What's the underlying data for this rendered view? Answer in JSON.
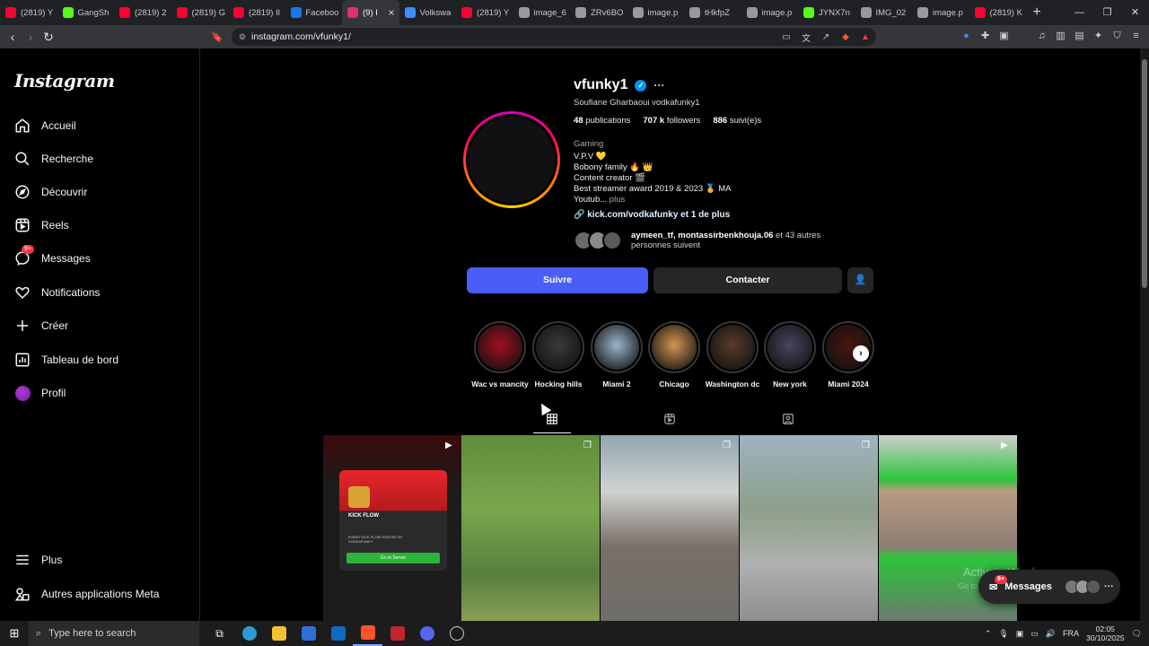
{
  "browser": {
    "tabs": [
      {
        "title": "(2819) Y",
        "color": "#ff0033"
      },
      {
        "title": "GangSh",
        "color": "#53fc18"
      },
      {
        "title": "(2819) 2",
        "color": "#ff0033"
      },
      {
        "title": "(2819) G",
        "color": "#ff0033"
      },
      {
        "title": "(2819) Il",
        "color": "#ff0033"
      },
      {
        "title": "Faceboo",
        "color": "#1877f2"
      },
      {
        "title": "(9) I",
        "color": "#e1306c",
        "active": true
      },
      {
        "title": "Volkswa",
        "color": "#3c8dff"
      },
      {
        "title": "(2819) Y",
        "color": "#ff0033"
      },
      {
        "title": "image_6",
        "color": "#999999"
      },
      {
        "title": "ZRv6BO",
        "color": "#999999"
      },
      {
        "title": "image.p",
        "color": "#999999"
      },
      {
        "title": "tHkfpZ",
        "color": "#999999"
      },
      {
        "title": "image.p",
        "color": "#999999"
      },
      {
        "title": "JYNX7n",
        "color": "#53fc18"
      },
      {
        "title": "IMG_02",
        "color": "#999999"
      },
      {
        "title": "image.p",
        "color": "#999999"
      },
      {
        "title": "(2819) K",
        "color": "#ff0033"
      }
    ],
    "new_tab": "+",
    "url": "instagram.com/vfunky1/"
  },
  "sidebar": {
    "logo": "Instagram",
    "items": [
      {
        "label": "Accueil",
        "icon": "home-icon"
      },
      {
        "label": "Recherche",
        "icon": "search-icon"
      },
      {
        "label": "Découvrir",
        "icon": "compass-icon"
      },
      {
        "label": "Reels",
        "icon": "reels-icon"
      },
      {
        "label": "Messages",
        "icon": "messenger-icon",
        "badge": "9+"
      },
      {
        "label": "Notifications",
        "icon": "heart-icon"
      },
      {
        "label": "Créer",
        "icon": "plus-icon"
      },
      {
        "label": "Tableau de bord",
        "icon": "dashboard-icon"
      },
      {
        "label": "Profil",
        "icon": "avatar-icon"
      }
    ],
    "bottom": [
      {
        "label": "Plus",
        "icon": "menu-icon"
      },
      {
        "label": "Autres applications Meta",
        "icon": "meta-apps-icon"
      }
    ]
  },
  "profile": {
    "username": "vfunky1",
    "more": "···",
    "full_name": "Soufiane Gharbaoui vodkafunky1",
    "stats": {
      "posts_num": "48",
      "posts_label": "publications",
      "followers_num": "707 k",
      "followers_label": "followers",
      "following_num": "886",
      "following_label": "suivi(e)s"
    },
    "category": "Gaming",
    "bio": [
      "V.P.V 💛",
      "Bobony family 🔥 👑",
      "Content creator 🎬",
      "Best streamer award 2019 & 2023 🏅 MA"
    ],
    "bio_truncated": "Youtub...",
    "bio_more": "plus",
    "link": "kick.com/vodkafunky et 1 de plus",
    "followed_by_names": "aymeen_tf, montassirbenkhouja.06",
    "followed_by_rest": "et 43 autres personnes suivent",
    "follow_btn": "Suivre",
    "contact_btn": "Contacter"
  },
  "highlights": [
    {
      "label": "Wac vs mancity",
      "color": "#a3101f"
    },
    {
      "label": "Hocking hills",
      "color": "#3a3a3a"
    },
    {
      "label": "Miami 2",
      "color": "#9bb6cc"
    },
    {
      "label": "Chicago",
      "color": "#d59552"
    },
    {
      "label": "Washington dc",
      "color": "#5a3b2a"
    },
    {
      "label": "New york",
      "color": "#4a4560"
    },
    {
      "label": "Miami 2024",
      "color": "#4a1410"
    }
  ],
  "posts": [
    {
      "type": "reel",
      "bg": "linear-gradient(180deg,#3a0a0c 0%,#1c1c1c 30%,#1c1c1c 100%)"
    },
    {
      "type": "carousel",
      "bg": "linear-gradient(180deg,#5f8d3c 0%,#7aa64d 40%,#577f3e 75%,#8a9e56 100%)"
    },
    {
      "type": "carousel",
      "bg": "linear-gradient(180deg,#93a6b0 0%,#cfd3d2 30%,#7a6f66 60%,#6e6e6a 100%)"
    },
    {
      "type": "carousel",
      "bg": "linear-gradient(180deg,#9fb3c2 0%,#8da08a 40%,#b0b0b0 70%,#8e8e8e 100%)"
    },
    {
      "type": "reel",
      "bg": "linear-gradient(180deg,#cfcfcf 0%,#2cc53a 24%,#b79b80 30%,#8e7e76 60%,#2cc53a 66%,#6b7a70 100%)"
    }
  ],
  "kick_card": {
    "title": "KICK FLOW",
    "sub": "EVENT KICK FLOW HOSTED BY VODKAFUNKY",
    "btn": "Go to Server"
  },
  "messages_pill": {
    "label": "Messages",
    "badge": "9+"
  },
  "watermark": {
    "line1": "Activate Windows",
    "line2": "Go to Settings to activate Windows."
  },
  "taskbar": {
    "search_placeholder": "Type here to search",
    "lang": "FRA",
    "time": "02:05",
    "date": "30/10/2025"
  }
}
